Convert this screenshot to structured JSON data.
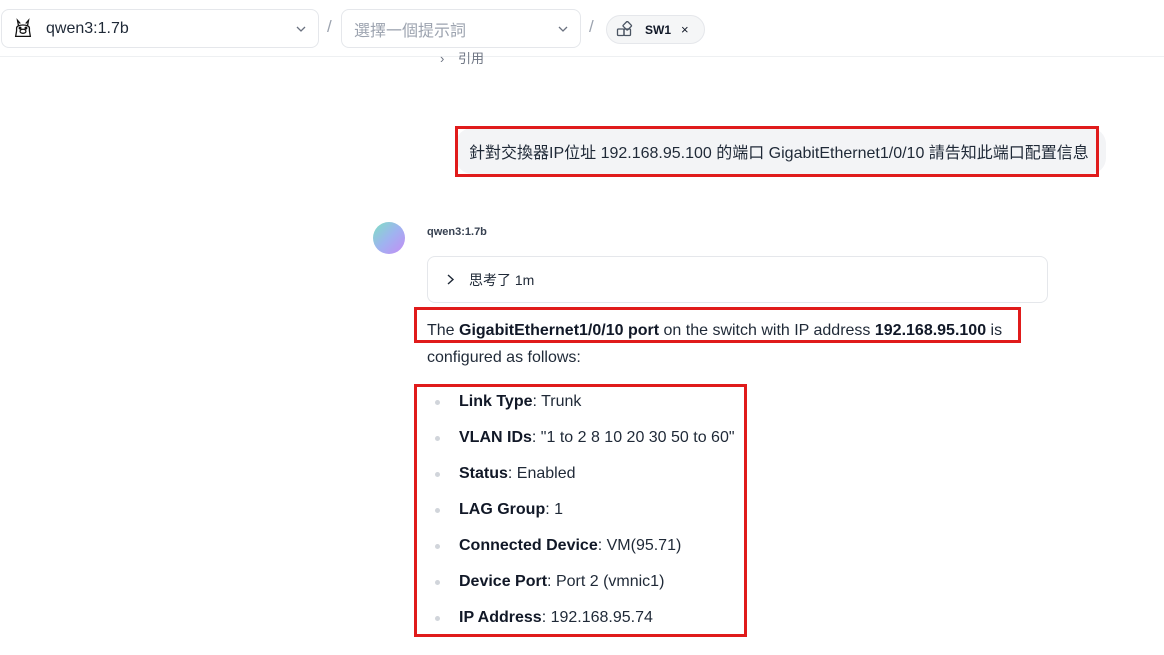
{
  "header": {
    "model_label": "qwen3:1.7b",
    "prompt_placeholder": "選擇一個提示詞",
    "separator": "/",
    "tag_label": "SW1",
    "tag_close": "×"
  },
  "partial_text": "引用",
  "user_message": "針對交換器IP位址 192.168.95.100 的端口 GigabitEthernet1/0/10 請告知此端口配置信息",
  "assistant": {
    "name": "qwen3:1.7b",
    "thinking_label": "思考了 1m",
    "intro": {
      "the": "The ",
      "port": "GigabitEthernet1/0/10 port",
      "mid": " on the switch with IP address ",
      "ip": "192.168.95.100",
      "tail": " is configured as follows:"
    },
    "config": [
      {
        "key": "Link Type",
        "value": ": Trunk"
      },
      {
        "key": "VLAN IDs",
        "value": ": \"1 to 2 8 10 20 30 50 to 60\""
      },
      {
        "key": "Status",
        "value": ": Enabled"
      },
      {
        "key": "LAG Group",
        "value": ": 1"
      },
      {
        "key": "Connected Device",
        "value": ": VM(95.71)"
      },
      {
        "key": "Device Port",
        "value": ": Port 2 (vmnic1)"
      },
      {
        "key": "IP Address",
        "value": ": 192.168.95.74"
      }
    ]
  },
  "colors": {
    "highlight": "#e01b1b",
    "bubble": "#f3f4f6"
  }
}
